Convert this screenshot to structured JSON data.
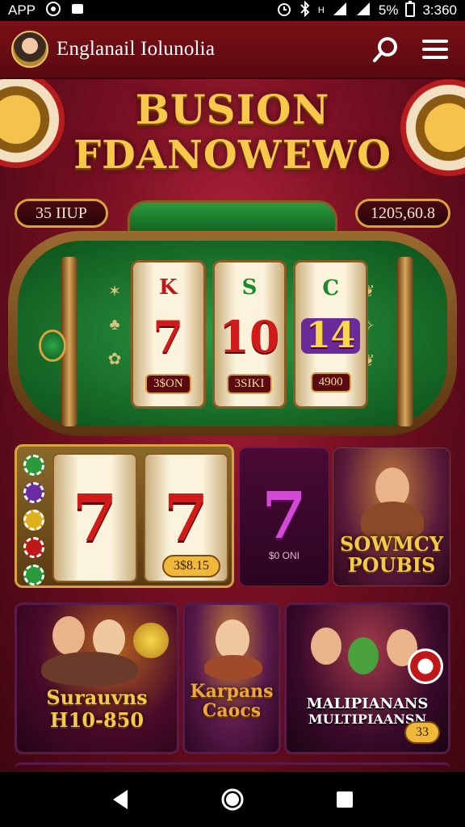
{
  "status_bar": {
    "left_text": "APP",
    "battery_percent": "5%",
    "time": "3:360",
    "icons": [
      "chrome-icon",
      "notification-icon",
      "alarm-icon",
      "bluetooth-icon",
      "network-icon",
      "wifi-icon",
      "signal-icon",
      "battery-icon"
    ]
  },
  "app_bar": {
    "title": "Englanail Iolunolia",
    "icons": [
      "avatar",
      "search-icon",
      "menu-icon"
    ]
  },
  "hero": {
    "title_line1": "BUSION",
    "title_line2": "FDANOWEWO",
    "left_pill": "35 IIUP",
    "right_pill": "1205,60.8"
  },
  "slot_machine": {
    "reels": [
      {
        "top": "K",
        "big": "7",
        "value": "3$ON"
      },
      {
        "top": "S",
        "big": "10",
        "value": "3SIKI"
      },
      {
        "top": "C",
        "big": "14",
        "value": "4900"
      }
    ]
  },
  "tiles_row2": {
    "slot": {
      "symbol": "7",
      "value": "3$8.15"
    },
    "seven": {
      "symbol": "7",
      "caption": "$0 ONI"
    },
    "sowmy": {
      "line1": "SOWMCY",
      "line2": "POUBIS"
    }
  },
  "tiles_row3": {
    "survivors": {
      "line1": "Surauvns",
      "line2": "H10-850"
    },
    "karl": {
      "line1": "Karpans",
      "line2": "Caocs"
    },
    "multi": {
      "line1": "MALIPIANANS",
      "line2": "MULTIPIAANSN",
      "value": "33"
    }
  },
  "nav_bar": {
    "icons": [
      "back-icon",
      "home-icon",
      "recents-icon"
    ]
  },
  "colors": {
    "app_bar": "#7a0f16",
    "gold": "#f7c84a",
    "felt_green": "#1e7a34"
  }
}
